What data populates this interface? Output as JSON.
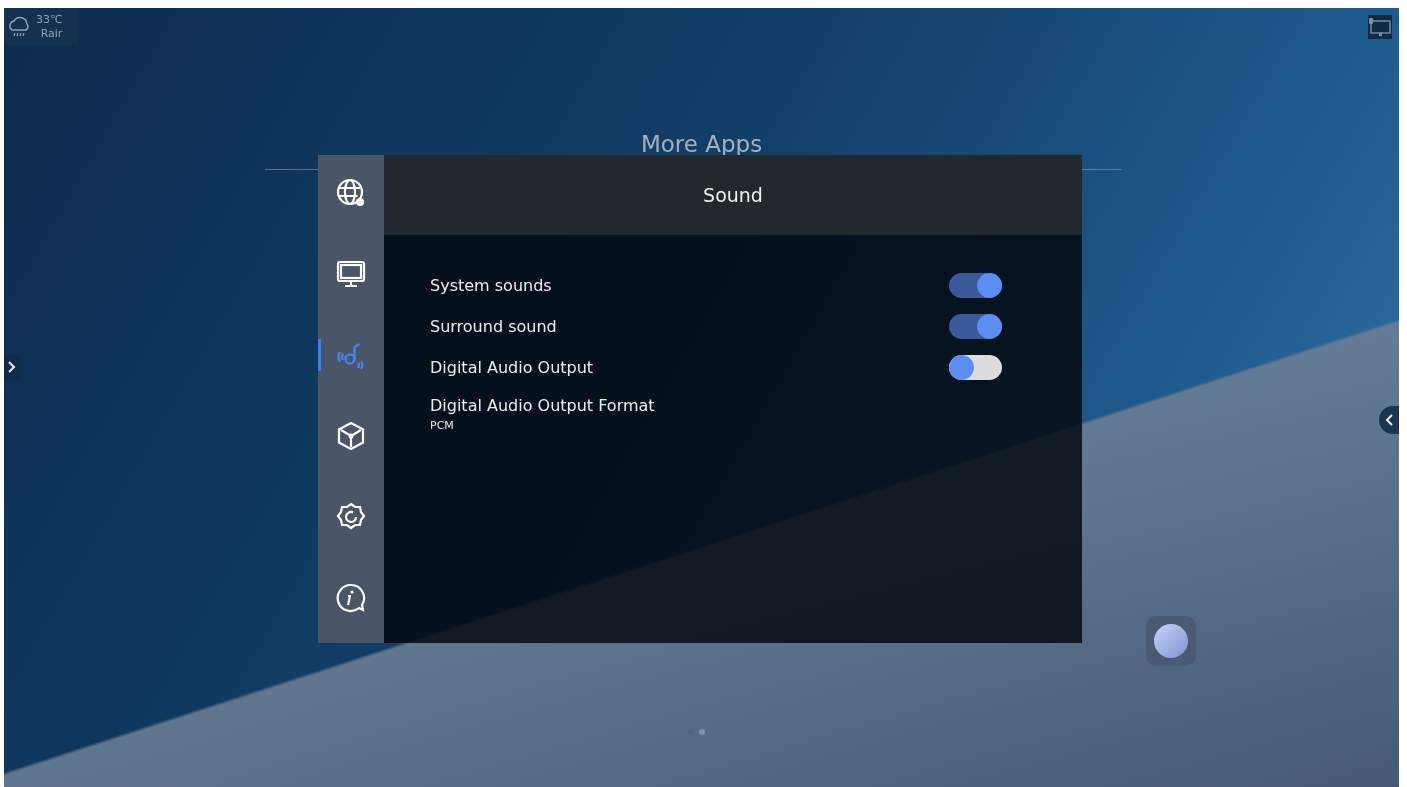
{
  "status": {
    "temperature": "33℃",
    "weather": "Rair"
  },
  "desktop": {
    "title": "More Apps",
    "pages": [
      {
        "selected": true
      },
      {
        "selected": false
      }
    ]
  },
  "dialog": {
    "title": "Sound",
    "sidebar": [
      {
        "kind": "network",
        "selected": false
      },
      {
        "kind": "display",
        "selected": false
      },
      {
        "kind": "sound",
        "selected": true
      },
      {
        "kind": "apps",
        "selected": false
      },
      {
        "kind": "settings",
        "selected": false
      },
      {
        "kind": "about",
        "selected": false
      }
    ],
    "settings": [
      {
        "kind": "toggle",
        "label": "System sounds",
        "on": true
      },
      {
        "kind": "toggle",
        "label": "Surround sound",
        "on": true
      },
      {
        "kind": "toggle",
        "label": "Digital Audio Output",
        "on": false
      },
      {
        "kind": "value",
        "label": "Digital Audio Output Format",
        "value": "PCM"
      }
    ]
  }
}
